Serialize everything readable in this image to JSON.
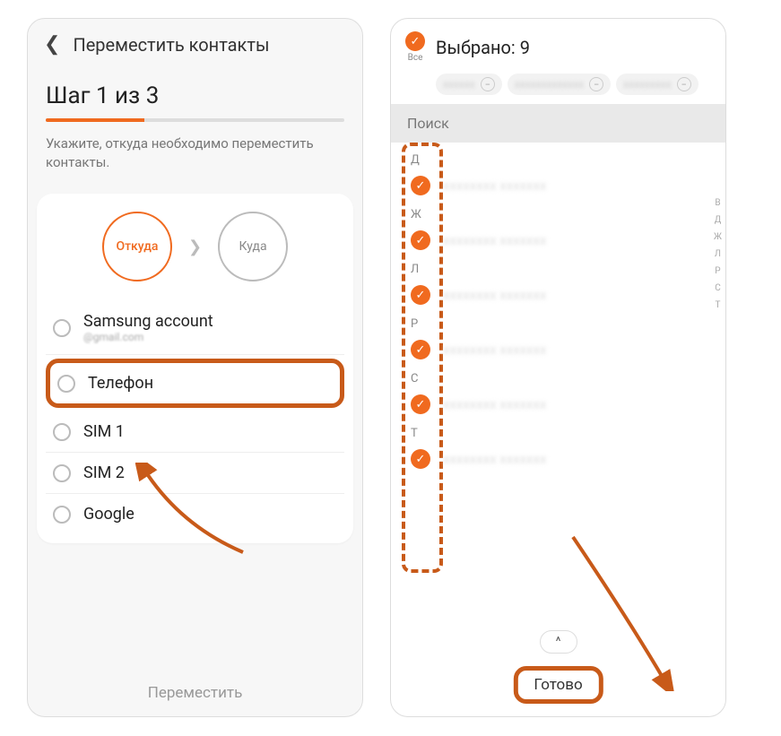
{
  "left": {
    "header_title": "Переместить контакты",
    "step_title": "Шаг 1 из 3",
    "progress_percent": 33,
    "instruction": "Укажите, откуда необходимо переместить контакты.",
    "from_label": "Откуда",
    "to_label": "Куда",
    "sources": [
      {
        "name": "Samsung account",
        "sub": "@gmail.com",
        "highlight": false
      },
      {
        "name": "Телефон",
        "sub": "",
        "highlight": true
      },
      {
        "name": "SIM 1",
        "sub": "",
        "highlight": false
      },
      {
        "name": "SIM 2",
        "sub": "",
        "highlight": false
      },
      {
        "name": "Google",
        "sub": "",
        "highlight": false
      }
    ],
    "bottom_action": "Переместить"
  },
  "right": {
    "all_label": "Все",
    "selected_title": "Выбрано: 9",
    "search_label": "Поиск",
    "chips": [
      "xxxxxx",
      "xxxxxxxxxxxxx",
      "xxxxxxxxx"
    ],
    "sections": [
      {
        "letter": "Д",
        "rows": 1
      },
      {
        "letter": "Ж",
        "rows": 1
      },
      {
        "letter": "Л",
        "rows": 1
      },
      {
        "letter": "Р",
        "rows": 1
      },
      {
        "letter": "С",
        "rows": 1
      },
      {
        "letter": "Т",
        "rows": 1
      }
    ],
    "index_letters": [
      "В",
      "Д",
      "Ж",
      "Л",
      "Р",
      "С",
      "Т"
    ],
    "done_label": "Готово"
  }
}
